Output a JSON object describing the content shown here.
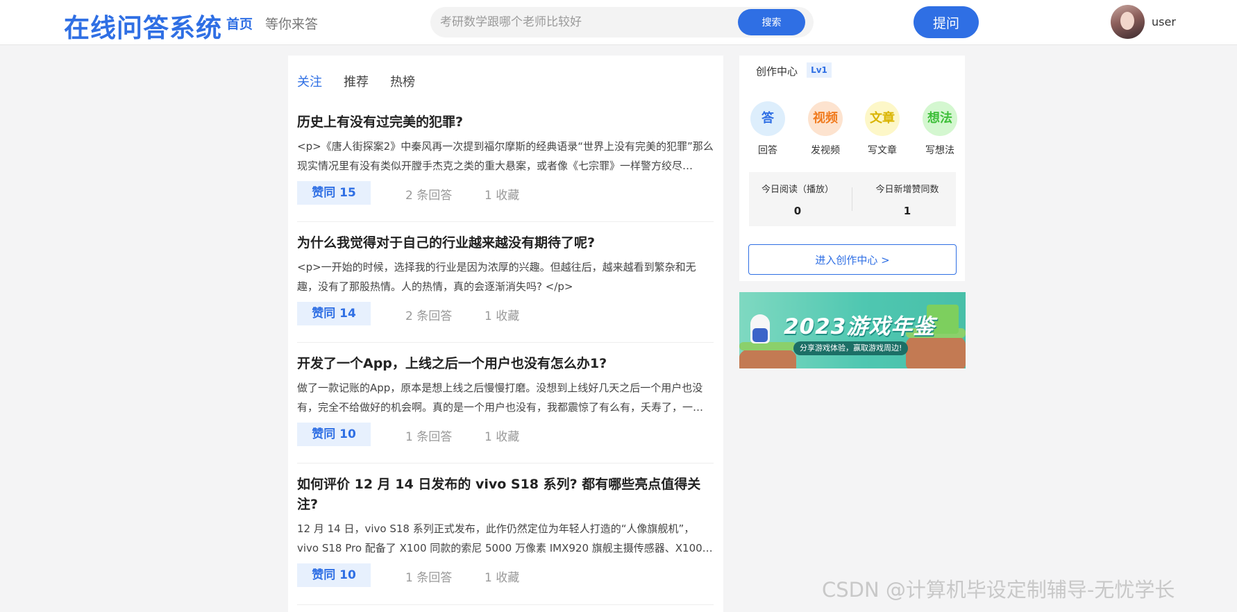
{
  "header": {
    "logo": "在线问答系统",
    "nav": [
      "首页",
      "等你来答"
    ],
    "search": {
      "placeholder": "考研数学跟哪个老师比较好",
      "button": "搜索"
    },
    "ask_button": "提问",
    "username": "user"
  },
  "feed": {
    "tabs": [
      "关注",
      "推荐",
      "热榜"
    ],
    "active_tab": "关注",
    "questions": [
      {
        "title": "历史上有没有过完美的犯罪?",
        "excerpt": "<p>《唐人街探案2》中秦风再一次提到福尔摩斯的经典语录“世界上没有完美的犯罪”那么现实情况里有没有类似开膛手杰克之类的重大悬案，或者像《七宗罪》一样警方绞尽…",
        "agree": "赞同 15",
        "answers": "2 条回答",
        "favorites": "1 收藏"
      },
      {
        "title": "为什么我觉得对于自己的行业越来越没有期待了呢?",
        "excerpt": "<p>一开始的时候，选择我的行业是因为浓厚的兴趣。但越往后，越来越看到繁杂和无趣，没有了那股热情。人的热情，真的会逐渐消失吗? </p>",
        "agree": "赞同 14",
        "answers": "2 条回答",
        "favorites": "1 收藏"
      },
      {
        "title": "开发了一个App，上线之后一个用户也没有怎么办1?",
        "excerpt": "做了一款记账的App，原本是想上线之后慢慢打磨。没想到上线好几天之后一个用户也没有，完全不给做好的机会啊。真的是一个用户也没有，我都震惊了有么有，夭寿了，一…",
        "agree": "赞同 10",
        "answers": "1 条回答",
        "favorites": "1 收藏"
      },
      {
        "title": "如何评价 12 月 14 日发布的 vivo S18 系列? 都有哪些亮点值得关注?",
        "excerpt": "12 月 14 日，vivo S18 系列正式发布，此作仍然定位为年轻人打造的“人像旗舰机”，vivo S18 Pro 配备了 X100 同款的索尼 5000 万像素 IMX920 旗舰主摄传感器、X100…",
        "agree": "赞同 10",
        "answers": "1 条回答",
        "favorites": "1 收藏"
      }
    ]
  },
  "sidebar": {
    "creation_title": "创作中心",
    "level": "Lv1",
    "quick_actions": [
      {
        "icon_text": "答",
        "label": "回答",
        "icon": "answer-icon",
        "color": "#2f6fe4",
        "bg": "#ddeefc"
      },
      {
        "icon_text": "视频",
        "label": "发视频",
        "icon": "video-icon",
        "color": "#f07a1d",
        "bg": "#fde3cf"
      },
      {
        "icon_text": "文章",
        "label": "写文章",
        "icon": "article-icon",
        "color": "#d9b400",
        "bg": "#fdf7c8"
      },
      {
        "icon_text": "想法",
        "label": "写想法",
        "icon": "idea-icon",
        "color": "#3fbf3a",
        "bg": "#d4f7d0"
      }
    ],
    "stats": [
      {
        "label": "今日阅读（播放）",
        "value": "0"
      },
      {
        "label": "今日新增赞同数",
        "value": "1"
      }
    ],
    "enter_button": "进入创作中心 >"
  },
  "banner": {
    "title": "2023游戏年鉴",
    "subtitle": "分享游戏体验，赢取游戏周边!"
  },
  "watermark": "CSDN @计算机毕设定制辅导-无忧学长",
  "colors": {
    "accent": "#2f6fe4",
    "background": "#f4f4f5"
  }
}
